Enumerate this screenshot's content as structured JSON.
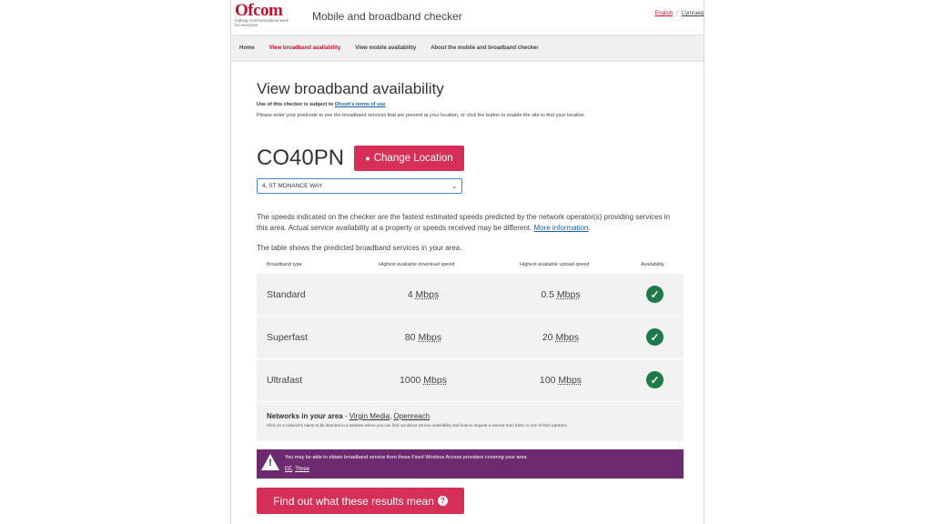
{
  "header": {
    "logo_text": "Ofcom",
    "logo_tagline_1": "making communications work",
    "logo_tagline_2": "for everyone",
    "app_title": "Mobile and broadband checker",
    "lang_english": "English",
    "lang_separator": "|",
    "lang_welsh": "Cymraeg"
  },
  "nav": [
    {
      "label": "Home",
      "active": false
    },
    {
      "label": "View broadband availability",
      "active": true
    },
    {
      "label": "View mobile availability",
      "active": false
    },
    {
      "label": "About the mobile and broadband checker",
      "active": false
    }
  ],
  "main": {
    "title": "View broadband availability",
    "terms_prefix": "Use of this checker is subject to ",
    "terms_link": "Ofcom's terms of use",
    "instructions": "Please enter your postcode to see the broadband services that are present at your location, or click the button to enable the site to find your location",
    "postcode": "CO40PN",
    "change_location_label": "Change Location",
    "address_selected": "4, ST MONANCE WAY",
    "speeds_text": "The speeds indicated on the checker are the fastest estimated speeds predicted by the network operator(s) providing services in this area. Actual service availability at a property or speeds received may be different.",
    "more_info_link": "More information",
    "table_note": "The table shows the predicted broadband services in your area."
  },
  "table": {
    "headers": {
      "type": "Broadband type",
      "download": "Highest available download speed",
      "upload": "Highest available upload speed",
      "availability": "Availability"
    },
    "rows": [
      {
        "type": "Standard",
        "down_value": "4",
        "down_unit": "Mbps",
        "up_value": "0.5",
        "up_unit": "Mbps",
        "available": true
      },
      {
        "type": "Superfast",
        "down_value": "80",
        "down_unit": "Mbps",
        "up_value": "20",
        "up_unit": "Mbps",
        "available": true
      },
      {
        "type": "Ultrafast",
        "down_value": "1000",
        "down_unit": "Mbps",
        "up_value": "100",
        "up_unit": "Mbps",
        "available": true
      }
    ]
  },
  "networks": {
    "label": "Networks in your area",
    "dash": " - ",
    "items": [
      "Virgin Media",
      "Openreach"
    ],
    "note": "Click on a network's name to be directed to a website where you can find out about service availability and how to request a service from them or one of their partners."
  },
  "fwa": {
    "text": "You may be able to obtain broadband service from these Fixed Wireless Access providers covering your area.",
    "providers": [
      "EE",
      "Three"
    ]
  },
  "cta": {
    "label": "Find out what these results mean"
  },
  "colors": {
    "brand": "#c8102e",
    "button": "#d62f58",
    "check": "#1f7a4a",
    "fwa_banner": "#6e2a6e"
  }
}
